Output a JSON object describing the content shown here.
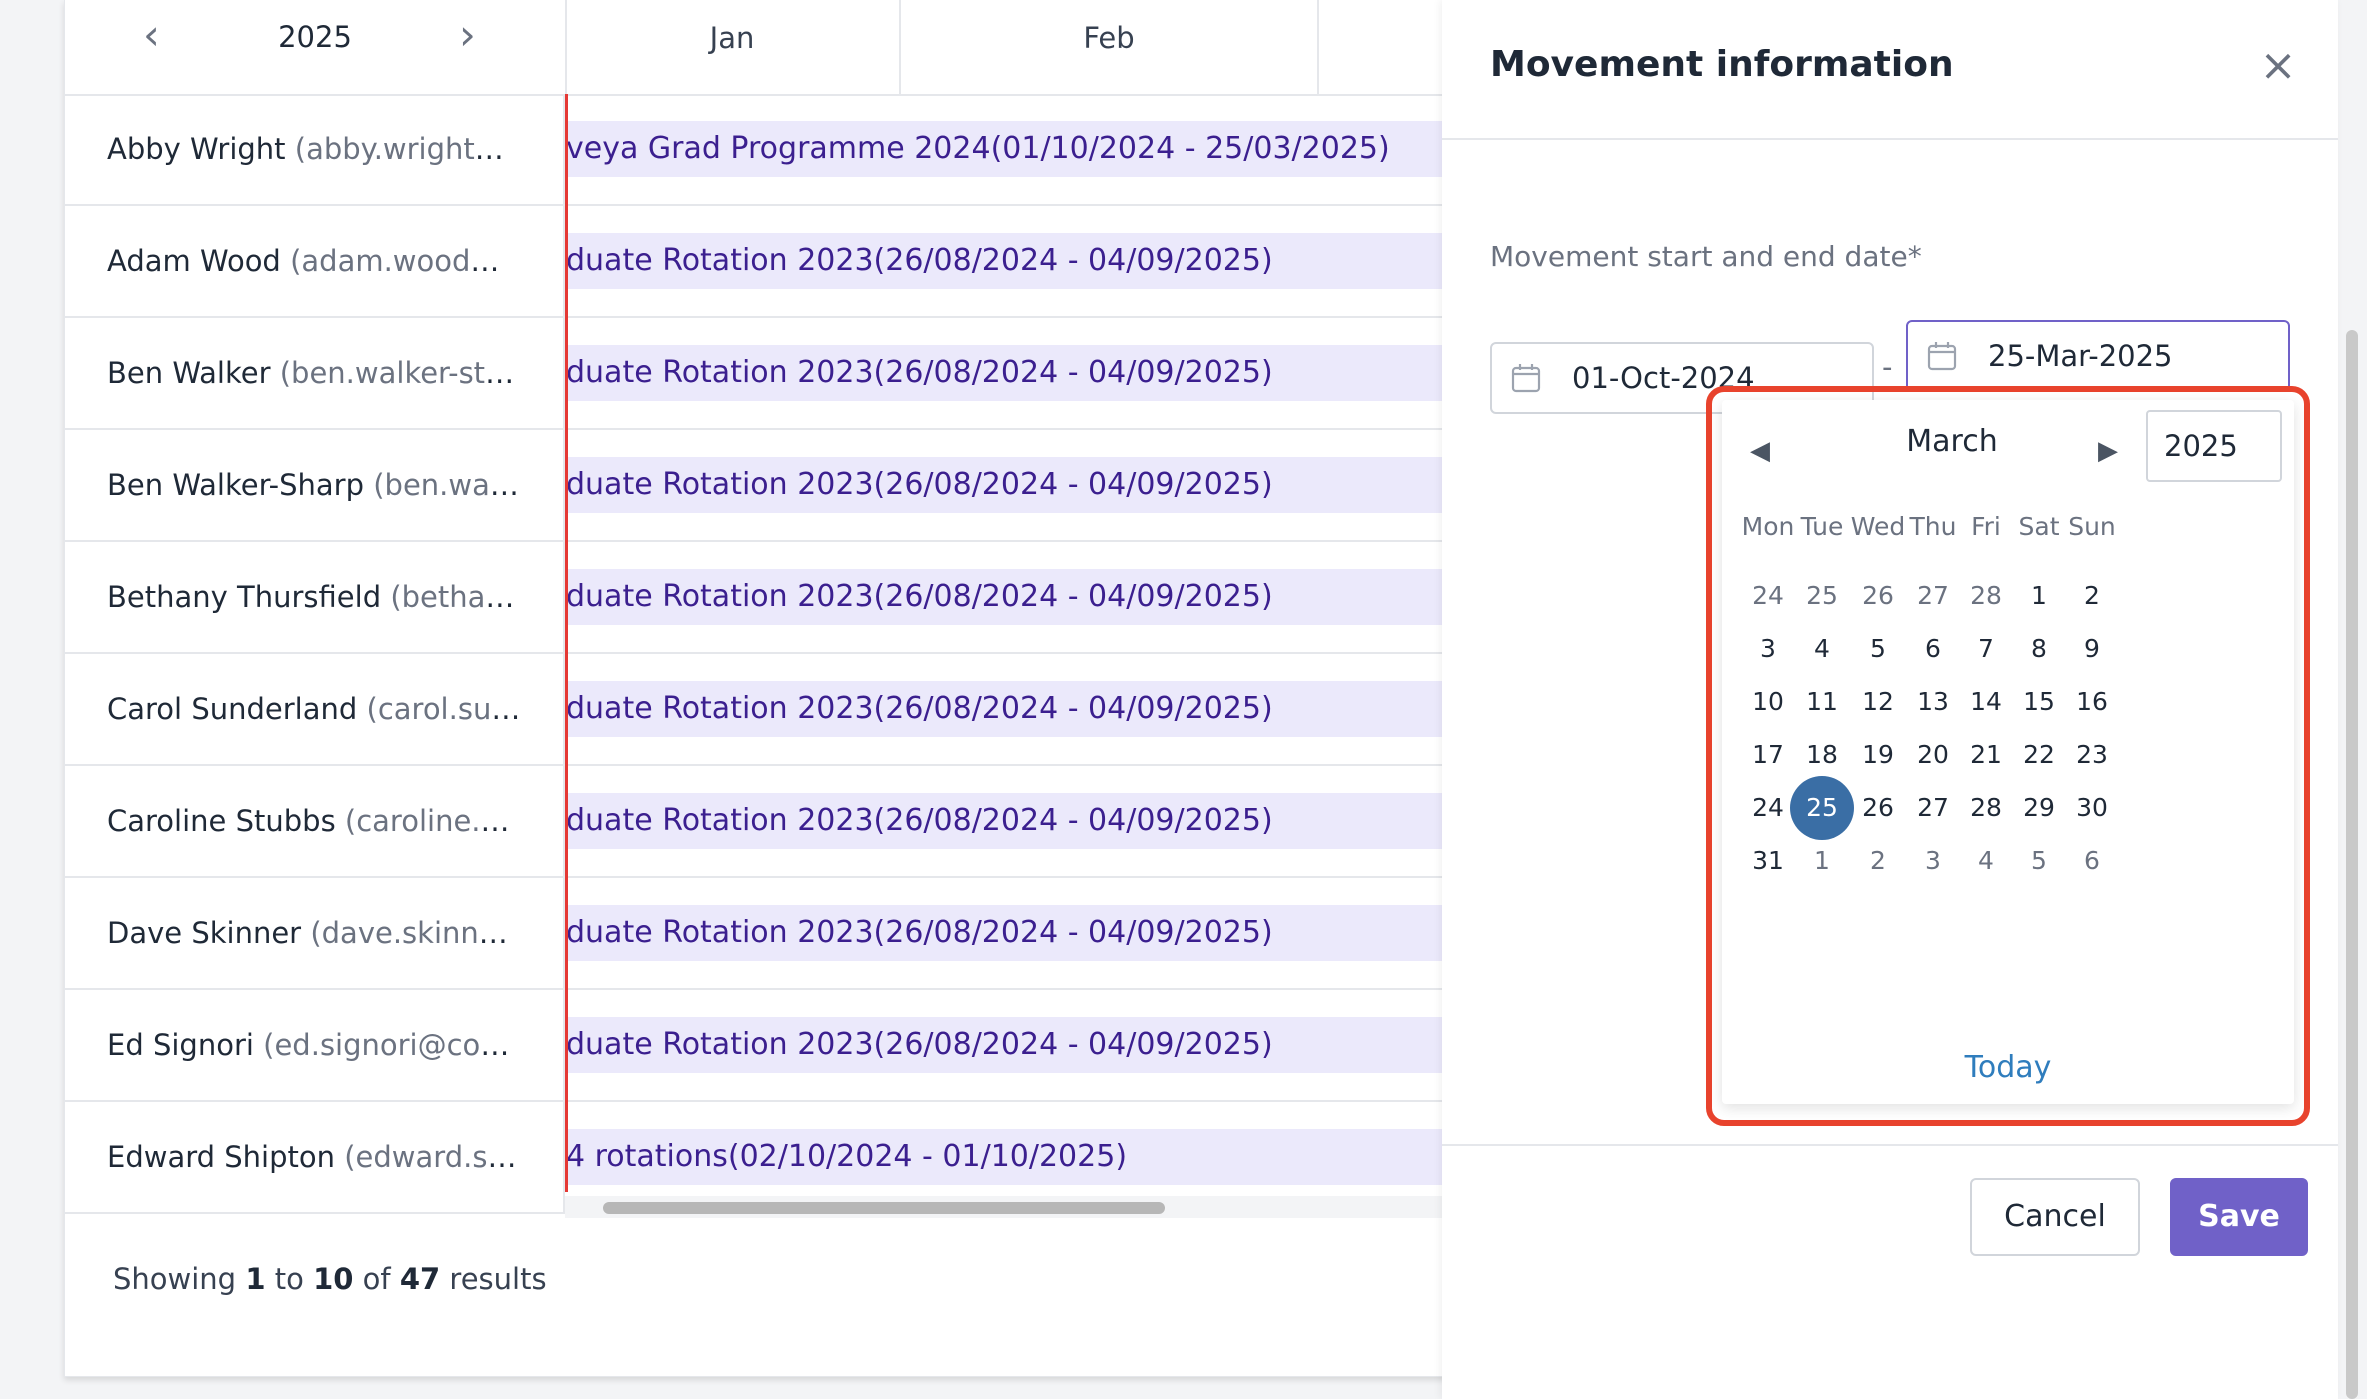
{
  "timeline": {
    "year": "2025",
    "months": [
      "Jan",
      "Feb"
    ],
    "rows": [
      {
        "name": "Abby Wright",
        "email": "(abby.wright@...",
        "bar": "veya Grad Programme 2024(01/10/2024 - 25/03/2025)"
      },
      {
        "name": "Adam Wood",
        "email": "(adam.wood@...",
        "bar": "duate Rotation 2023(26/08/2024 - 04/09/2025)"
      },
      {
        "name": "Ben Walker",
        "email": "(ben.walker-sta...",
        "bar": "duate Rotation 2023(26/08/2024 - 04/09/2025)"
      },
      {
        "name": "Ben Walker-Sharp",
        "email": "(ben.walk...",
        "bar": "duate Rotation 2023(26/08/2024 - 04/09/2025)"
      },
      {
        "name": "Bethany Thursfield",
        "email": "(bethany...",
        "bar": "duate Rotation 2023(26/08/2024 - 04/09/2025)"
      },
      {
        "name": "Carol Sunderland",
        "email": "(carol.sun...",
        "bar": "duate Rotation 2023(26/08/2024 - 04/09/2025)"
      },
      {
        "name": "Caroline Stubbs",
        "email": "(caroline.st...",
        "bar": "duate Rotation 2023(26/08/2024 - 04/09/2025)"
      },
      {
        "name": "Dave Skinner",
        "email": "(dave.skinner...",
        "bar": "duate Rotation 2023(26/08/2024 - 04/09/2025)"
      },
      {
        "name": "Ed Signori",
        "email": "(ed.signori@conv...",
        "bar": "duate Rotation 2023(26/08/2024 - 04/09/2025)"
      },
      {
        "name": "Edward Shipton",
        "email": "(edward.shi...",
        "bar": "4 rotations(02/10/2024 - 01/10/2025)"
      }
    ],
    "results": {
      "prefix": "Showing",
      "from": "1",
      "to_word": "to",
      "to": "10",
      "of_word": "of",
      "total": "47",
      "suffix": "results"
    }
  },
  "panel": {
    "title": "Movement information",
    "field_label": "Movement start and end date*",
    "start_date": "01-Oct-2024",
    "separator": "-",
    "end_date": "25-Mar-2025",
    "cancel_label": "Cancel",
    "save_label": "Save"
  },
  "calendar": {
    "month": "March",
    "year": "2025",
    "weekdays": [
      "Mon",
      "Tue",
      "Wed",
      "Thu",
      "Fri",
      "Sat",
      "Sun"
    ],
    "weeks": [
      [
        "24",
        "25",
        "26",
        "27",
        "28",
        "1",
        "2"
      ],
      [
        "3",
        "4",
        "5",
        "6",
        "7",
        "8",
        "9"
      ],
      [
        "10",
        "11",
        "12",
        "13",
        "14",
        "15",
        "16"
      ],
      [
        "17",
        "18",
        "19",
        "20",
        "21",
        "22",
        "23"
      ],
      [
        "24",
        "25",
        "26",
        "27",
        "28",
        "29",
        "30"
      ],
      [
        "31",
        "1",
        "2",
        "3",
        "4",
        "5",
        "6"
      ]
    ],
    "selected_day": "25",
    "today_label": "Today"
  },
  "colors": {
    "accent": "#7061c8",
    "selected_day": "#3a6ea5",
    "highlight_border": "#e8432d",
    "today_line": "#e53935",
    "bar_bg": "#ebe9fb",
    "bar_text": "#3b1f8f"
  }
}
